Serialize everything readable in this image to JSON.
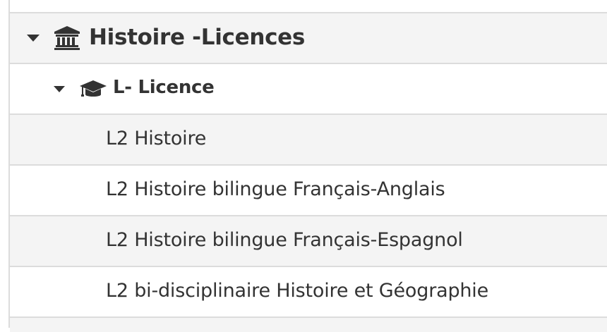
{
  "tree": {
    "partial_top_label": "...",
    "faculty": {
      "label": "Histoire -Licences",
      "icon": "institution-icon"
    },
    "degree": {
      "label": "L- Licence",
      "icon": "graduation-cap-icon"
    },
    "programs": [
      {
        "label": "L2 Histoire"
      },
      {
        "label": "L2 Histoire bilingue Français-Anglais"
      },
      {
        "label": "L2 Histoire bilingue Français-Espagnol"
      },
      {
        "label": "L2 bi-disciplinaire Histoire et Géographie"
      }
    ]
  },
  "colors": {
    "shaded_row": "#f4f4f4",
    "border": "#dcdcdc",
    "text": "#333333"
  }
}
